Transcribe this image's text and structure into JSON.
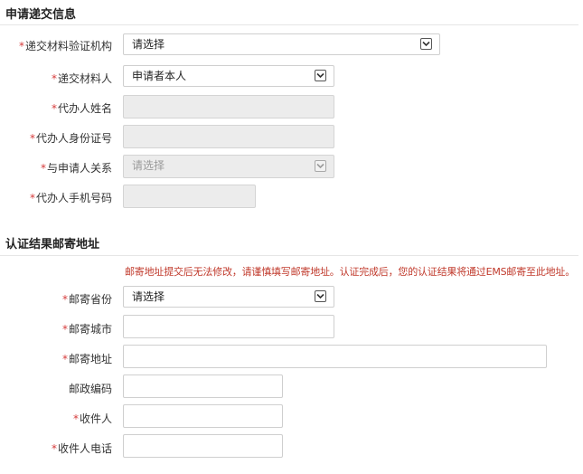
{
  "sections": {
    "application": {
      "title": "申请递交信息"
    },
    "mailing": {
      "title": "认证结果邮寄地址"
    }
  },
  "application_fields": {
    "verify_institution": {
      "label": "递交材料验证机构",
      "required": true,
      "value": "请选择"
    },
    "submitter": {
      "label": "递交材料人",
      "required": true,
      "value": "申请者本人"
    },
    "agent_name": {
      "label": "代办人姓名",
      "required": true,
      "value": ""
    },
    "agent_id": {
      "label": "代办人身份证号",
      "required": true,
      "value": ""
    },
    "relationship": {
      "label": "与申请人关系",
      "required": true,
      "value": "请选择"
    },
    "agent_phone": {
      "label": "代办人手机号码",
      "required": true,
      "value": ""
    }
  },
  "mailing_notice": "邮寄地址提交后无法修改，请谨慎填写邮寄地址。认证完成后，您的认证结果将通过EMS邮寄至此地址。",
  "mailing_fields": {
    "province": {
      "label": "邮寄省份",
      "required": true,
      "value": "请选择"
    },
    "city": {
      "label": "邮寄城市",
      "required": true,
      "value": ""
    },
    "address": {
      "label": "邮寄地址",
      "required": true,
      "value": ""
    },
    "postcode": {
      "label": "邮政编码",
      "required": false,
      "value": ""
    },
    "recipient": {
      "label": "收件人",
      "required": true,
      "value": ""
    },
    "recipient_phone": {
      "label": "收件人电话",
      "required": true,
      "value": ""
    }
  },
  "required_mark": "*",
  "colors": {
    "required": "#d63b3b",
    "notice": "#c0392b",
    "disabled_bg": "#ececec"
  }
}
